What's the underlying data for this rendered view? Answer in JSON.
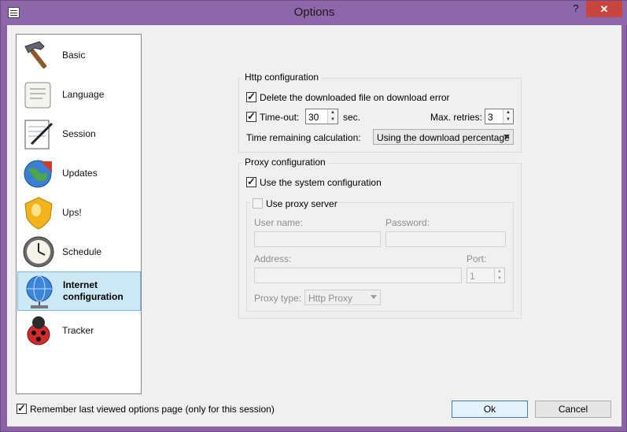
{
  "window": {
    "title": "Options",
    "help_label": "?",
    "close_label": "✕"
  },
  "sidebar": {
    "items": [
      {
        "label": "Basic",
        "icon": "hammer-icon"
      },
      {
        "label": "Language",
        "icon": "scroll-icon"
      },
      {
        "label": "Session",
        "icon": "notepad-pen-icon"
      },
      {
        "label": "Updates",
        "icon": "globe-arrow-icon"
      },
      {
        "label": "Ups!",
        "icon": "warning-shield-icon"
      },
      {
        "label": "Schedule",
        "icon": "clock-icon"
      },
      {
        "label": "Internet configuration",
        "icon": "network-globe-icon"
      },
      {
        "label": "Tracker",
        "icon": "ladybug-icon"
      }
    ],
    "selected_index": 6
  },
  "http": {
    "title": "Http configuration",
    "delete_label": "Delete the downloaded file on download error",
    "delete_checked": true,
    "timeout_label": "Time-out:",
    "timeout_checked": true,
    "timeout_value": "30",
    "timeout_unit": "sec.",
    "retries_label": "Max. retries:",
    "retries_value": "3",
    "remaining_label": "Time remaining calculation:",
    "remaining_value": "Using the download percentage"
  },
  "proxy": {
    "title": "Proxy configuration",
    "system_label": "Use the system configuration",
    "system_checked": true,
    "server_label": "Use proxy server",
    "server_checked": false,
    "username_label": "User name:",
    "password_label": "Password:",
    "address_label": "Address:",
    "port_label": "Port:",
    "port_value": "1",
    "type_label": "Proxy type:",
    "type_value": "Http Proxy"
  },
  "footer": {
    "remember_label": "Remember last viewed options page (only for this session)",
    "remember_checked": true,
    "ok_label": "Ok",
    "cancel_label": "Cancel"
  }
}
